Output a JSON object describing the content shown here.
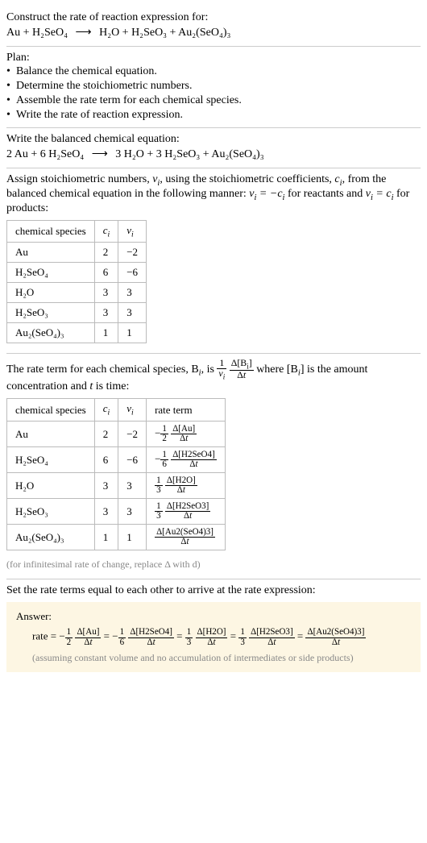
{
  "header": {
    "title": "Construct the rate of reaction expression for:",
    "equation_lhs": "Au + H₂SeO₄",
    "equation_arrow": "⟶",
    "equation_rhs": "H₂O + H₂SeO₃ + Au₂(SeO₄)₃"
  },
  "plan": {
    "title": "Plan:",
    "items": [
      "Balance the chemical equation.",
      "Determine the stoichiometric numbers.",
      "Assemble the rate term for each chemical species.",
      "Write the rate of reaction expression."
    ]
  },
  "balanced": {
    "title": "Write the balanced chemical equation:",
    "lhs": "2 Au + 6 H₂SeO₄",
    "arrow": "⟶",
    "rhs": "3 H₂O + 3 H₂SeO₃ + Au₂(SeO₄)₃"
  },
  "stoich": {
    "intro_a": "Assign stoichiometric numbers, ",
    "intro_b": ", using the stoichiometric coefficients, ",
    "intro_c": ", from the balanced chemical equation in the following manner: ",
    "intro_d": " for reactants and ",
    "intro_e": " for products:",
    "headers": {
      "species": "chemical species",
      "c": "cᵢ",
      "v": "νᵢ"
    },
    "rows": [
      {
        "species": "Au",
        "c": "2",
        "v": "−2"
      },
      {
        "species": "H₂SeO₄",
        "c": "6",
        "v": "−6"
      },
      {
        "species": "H₂O",
        "c": "3",
        "v": "3"
      },
      {
        "species": "H₂SeO₃",
        "c": "3",
        "v": "3"
      },
      {
        "species": "Au₂(SeO₄)₃",
        "c": "1",
        "v": "1"
      }
    ]
  },
  "rateterm": {
    "intro_a": "The rate term for each chemical species, B",
    "intro_b": ", is ",
    "intro_c": " where [B",
    "intro_d": "] is the amount concentration and ",
    "intro_e": " is time:",
    "headers": {
      "species": "chemical species",
      "c": "cᵢ",
      "v": "νᵢ",
      "rate": "rate term"
    },
    "rows": [
      {
        "species": "Au",
        "c": "2",
        "v": "−2",
        "coef_sign": "−",
        "coef_num": "1",
        "coef_den": "2",
        "delta": "Δ[Au]"
      },
      {
        "species": "H₂SeO₄",
        "c": "6",
        "v": "−6",
        "coef_sign": "−",
        "coef_num": "1",
        "coef_den": "6",
        "delta": "Δ[H2SeO4]"
      },
      {
        "species": "H₂O",
        "c": "3",
        "v": "3",
        "coef_sign": "",
        "coef_num": "1",
        "coef_den": "3",
        "delta": "Δ[H2O]"
      },
      {
        "species": "H₂SeO₃",
        "c": "3",
        "v": "3",
        "coef_sign": "",
        "coef_num": "1",
        "coef_den": "3",
        "delta": "Δ[H2SeO3]"
      },
      {
        "species": "Au₂(SeO₄)₃",
        "c": "1",
        "v": "1",
        "coef_sign": "",
        "coef_num": "",
        "coef_den": "",
        "delta": "Δ[Au2(SeO4)3]"
      }
    ],
    "note": "(for infinitesimal rate of change, replace Δ with d)"
  },
  "final": {
    "title": "Set the rate terms equal to each other to arrive at the rate expression:",
    "answer_label": "Answer:",
    "rate_label": "rate",
    "assume": "(assuming constant volume and no accumulation of intermediates or side products)",
    "eq": "=",
    "terms": [
      {
        "sign": "−",
        "num": "1",
        "den": "2",
        "delta": "Δ[Au]"
      },
      {
        "sign": "−",
        "num": "1",
        "den": "6",
        "delta": "Δ[H2SeO4]"
      },
      {
        "sign": "",
        "num": "1",
        "den": "3",
        "delta": "Δ[H2O]"
      },
      {
        "sign": "",
        "num": "1",
        "den": "3",
        "delta": "Δ[H2SeO3]"
      },
      {
        "sign": "",
        "num": "",
        "den": "",
        "delta": "Δ[Au2(SeO4)3]"
      }
    ]
  }
}
